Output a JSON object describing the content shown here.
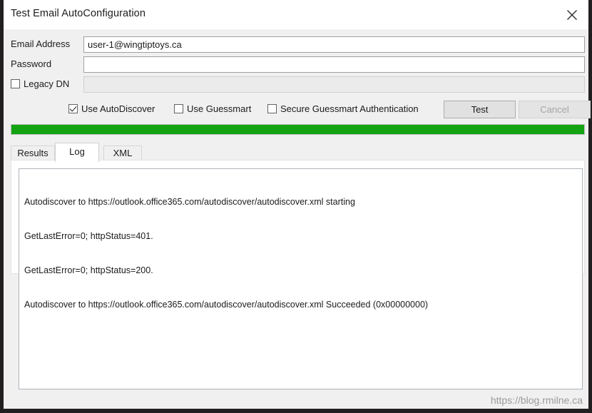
{
  "window": {
    "title": "Test Email AutoConfiguration",
    "close_icon": "close-icon"
  },
  "form": {
    "email": {
      "label": "Email Address",
      "value": "user-1@wingtiptoys.ca",
      "placeholder": ""
    },
    "password": {
      "label": "Password",
      "value": "",
      "placeholder": ""
    },
    "legacy_dn": {
      "label": "Legacy DN",
      "checked": false,
      "value": "",
      "placeholder": "",
      "disabled": true
    }
  },
  "options": {
    "use_autodiscover": {
      "label": "Use AutoDiscover",
      "checked": true
    },
    "use_guessmart": {
      "label": "Use Guessmart",
      "checked": false
    },
    "secure_guessmart": {
      "label": "Secure Guessmart Authentication",
      "checked": false
    }
  },
  "buttons": {
    "test": {
      "label": "Test",
      "enabled": true
    },
    "cancel": {
      "label": "Cancel",
      "enabled": false
    }
  },
  "progress": {
    "percent": 100,
    "color": "#13a313"
  },
  "tabs": [
    {
      "label": "Results",
      "active": false
    },
    {
      "label": "Log",
      "active": true
    },
    {
      "label": "XML",
      "active": false
    }
  ],
  "log": {
    "lines": [
      "Autodiscover to https://outlook.office365.com/autodiscover/autodiscover.xml starting",
      "GetLastError=0; httpStatus=401.",
      "GetLastError=0; httpStatus=200.",
      "Autodiscover to https://outlook.office365.com/autodiscover/autodiscover.xml Succeeded (0x00000000)"
    ]
  },
  "watermark": {
    "text": "https://blog.rmilne.ca"
  }
}
